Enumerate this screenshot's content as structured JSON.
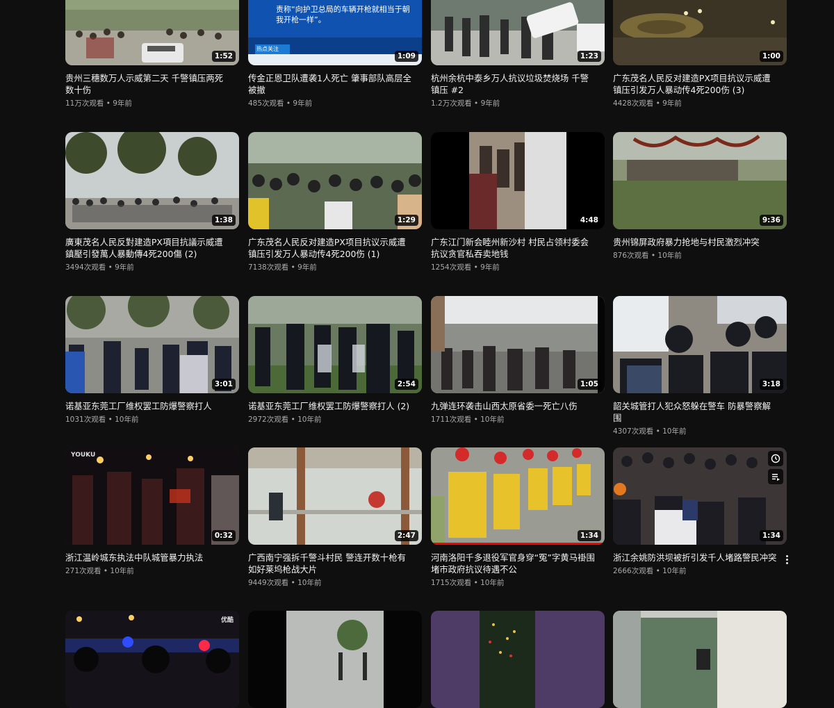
{
  "videos": [
    {
      "title": "贵州三穗数万人示威第二天 千警镇压两死数十伤",
      "views": "11万次观看",
      "age": "9年前",
      "duration": "1:52"
    },
    {
      "title": "传金正恩卫队遭袭1人死亡 肇事部队高层全被撤",
      "views": "485次观看",
      "age": "9年前",
      "duration": "1:09",
      "thumb_text": "责称“向护卫总局的车辆开枪就相当于朝我开枪一样”。",
      "thumb_tag": "热点关注"
    },
    {
      "title": "杭州余杭中泰乡万人抗议垃圾焚烧场 千警镇压 #2",
      "views": "1.2万次观看",
      "age": "9年前",
      "duration": "1:23"
    },
    {
      "title": "广东茂名人民反对建造PX项目抗议示威遭镇压引发万人暴动传4死200伤 (3)",
      "views": "4428次观看",
      "age": "9年前",
      "duration": "1:00"
    },
    {
      "title": "廣東茂名人民反對建造PX項目抗議示威遭鎮壓引發萬人暴動傳4死200傷 (2)",
      "views": "3494次观看",
      "age": "9年前",
      "duration": "1:38"
    },
    {
      "title": "广东茂名人民反对建造PX项目抗议示威遭镇压引发万人暴动传4死200伤 (1)",
      "views": "7138次观看",
      "age": "9年前",
      "duration": "1:29"
    },
    {
      "title": "广东江门新会睦州新沙村 村民占领村委会抗议贪官私吞卖地钱",
      "views": "1254次观看",
      "age": "9年前",
      "duration": "4:48"
    },
    {
      "title": "贵州锦屏政府暴力抢地与村民激烈冲突",
      "views": "876次观看",
      "age": "10年前",
      "duration": "9:36"
    },
    {
      "title": "诺基亚东莞工厂维权罢工防爆警察打人",
      "views": "1031次观看",
      "age": "10年前",
      "duration": "3:01"
    },
    {
      "title": "诺基亚东莞工厂维权罢工防爆警察打人 (2)",
      "views": "2972次观看",
      "age": "10年前",
      "duration": "2:54"
    },
    {
      "title": "九弹连环袭击山西太原省委一死亡八伤",
      "views": "1711次观看",
      "age": "10年前",
      "duration": "1:05"
    },
    {
      "title": "韶关城管打人犯众怒躲在警车 防暴警察解围",
      "views": "4307次观看",
      "age": "10年前",
      "duration": "3:18"
    },
    {
      "title": "浙江温岭城东执法中队城管暴力执法",
      "views": "271次观看",
      "age": "10年前",
      "duration": "0:32",
      "logo": "YOUKU"
    },
    {
      "title": "广西南宁强拆千警斗村民 警连开数十枪有如好莱坞枪战大片",
      "views": "9449次观看",
      "age": "10年前",
      "duration": "2:47"
    },
    {
      "title": "河南洛阳千多退役军官身穿“冤”字黄马褂围堵市政府抗议待遇不公",
      "views": "1715次观看",
      "age": "10年前",
      "duration": "1:34",
      "watched": 1.0
    },
    {
      "title": "浙江余姚防洪坝被折引发千人堵路警民冲突",
      "views": "2666次观看",
      "age": "10年前",
      "duration": "1:34"
    },
    {
      "title": "",
      "views": "",
      "age": "",
      "duration": "",
      "logo": "优酷"
    },
    {
      "title": "",
      "views": "",
      "age": "",
      "duration": ""
    },
    {
      "title": "",
      "views": "",
      "age": "",
      "duration": ""
    },
    {
      "title": "",
      "views": "",
      "age": "",
      "duration": ""
    }
  ],
  "ui": {
    "meta_separator": " • ",
    "watch_later_icon": "clock-icon",
    "add_to_queue_icon": "queue-icon",
    "more_icon": "more-vert-icon"
  }
}
